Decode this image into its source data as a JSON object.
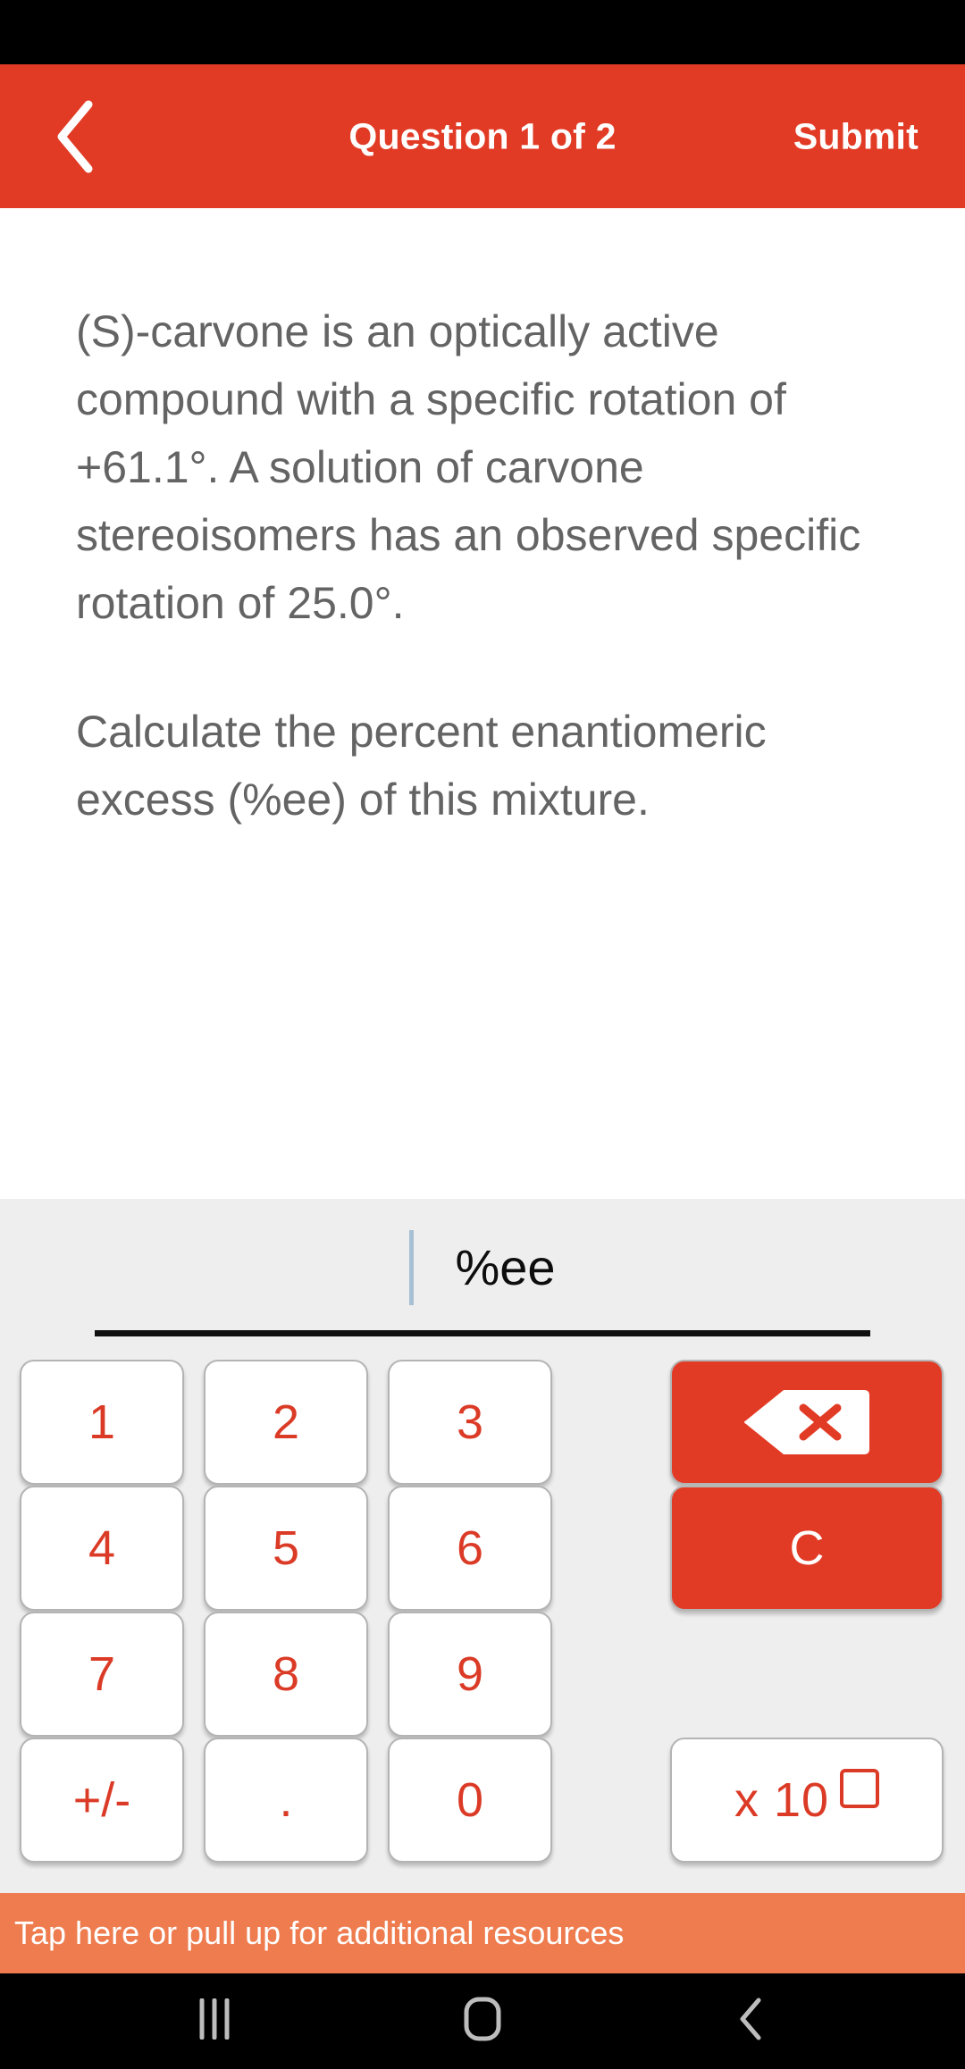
{
  "header": {
    "back_icon": "chevron-left-icon",
    "title": "Question 1 of 2",
    "submit_label": "Submit",
    "background_color": "#E23B25",
    "text_color": "#FFFFFF"
  },
  "question": {
    "paragraph_1": "(S)-carvone is an optically active compound with a specific rotation of +61.1°. A solution of carvone stereoisomers has an observed specific rotation of 25.0°.",
    "paragraph_2": "Calculate the percent enantiomeric excess (%ee) of this mixture.",
    "text_color": "#646464"
  },
  "answer": {
    "value": "",
    "unit": "%ee",
    "caret_color": "#A8C0D4",
    "underline_color": "#111111"
  },
  "keypad": {
    "keys": [
      {
        "label": "1",
        "name": "key-1"
      },
      {
        "label": "2",
        "name": "key-2"
      },
      {
        "label": "3",
        "name": "key-3"
      },
      {
        "label": "4",
        "name": "key-4"
      },
      {
        "label": "5",
        "name": "key-5"
      },
      {
        "label": "6",
        "name": "key-6"
      },
      {
        "label": "7",
        "name": "key-7"
      },
      {
        "label": "8",
        "name": "key-8"
      },
      {
        "label": "9",
        "name": "key-9"
      },
      {
        "label": "+/-",
        "name": "key-sign"
      },
      {
        "label": ".",
        "name": "key-decimal"
      },
      {
        "label": "0",
        "name": "key-0"
      }
    ],
    "backspace_icon": "backspace-icon",
    "clear_label": "C",
    "exponent_label": "x 10",
    "digit_color": "#DB3B26",
    "action_color": "#E23B25",
    "panel_color": "#EEEEEE"
  },
  "resources": {
    "label": "Tap here or pull up for additional resources",
    "background_color": "#EE7C4F"
  },
  "navbar": {
    "recents_icon": "recents-icon",
    "home_icon": "home-icon",
    "back_icon": "back-icon"
  }
}
